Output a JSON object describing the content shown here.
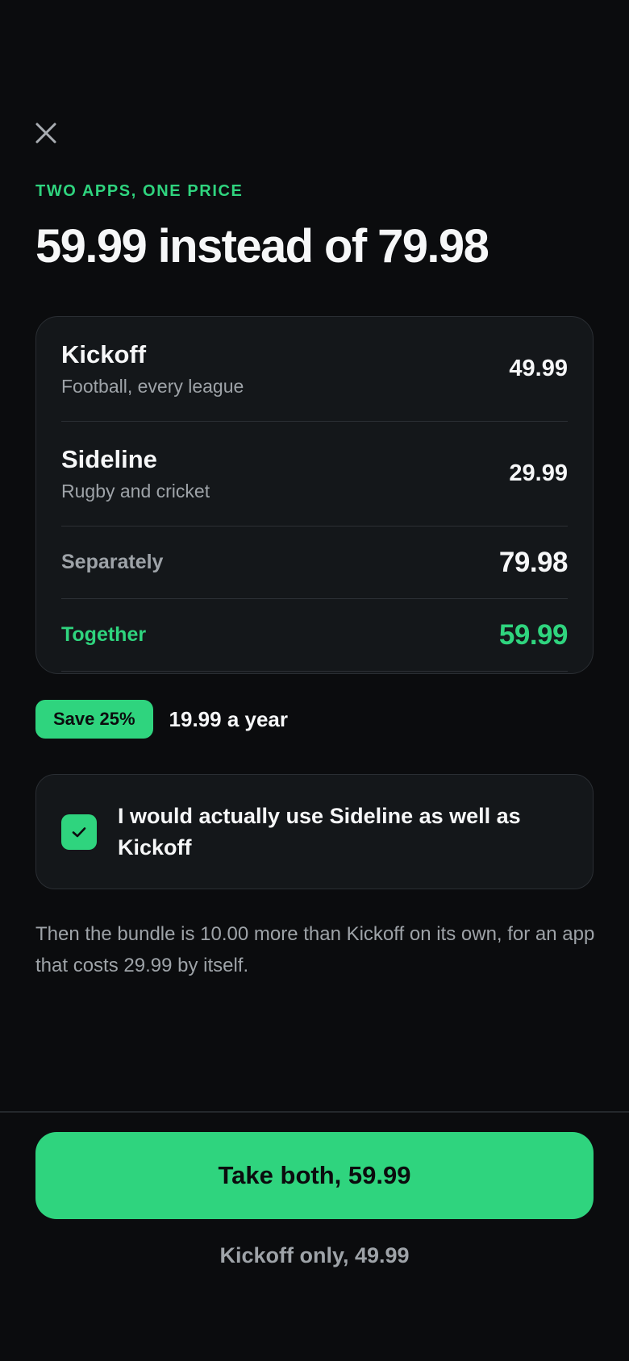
{
  "header": {
    "close_icon": "close-icon",
    "eyebrow": "TWO APPS, ONE PRICE",
    "headline": "59.99 instead of 79.98"
  },
  "comparison": {
    "apps": [
      {
        "name": "Kickoff",
        "description": "Football, every league",
        "price": "49.99"
      },
      {
        "name": "Sideline",
        "description": "Rugby and cricket",
        "price": "29.99"
      }
    ],
    "separately_label": "Separately",
    "separately_value": "79.98",
    "together_label": "Together",
    "together_value": "59.99"
  },
  "savings": {
    "badge": "Save 25%",
    "text": "19.99 a year"
  },
  "confirm": {
    "checked": true,
    "check_icon": "checkmark-icon",
    "text": "I would actually use Sideline as well as Kickoff"
  },
  "explanation": "Then the bundle is 10.00 more than Kickoff on its own, for an app that costs 29.99 by itself.",
  "actions": {
    "primary_label": "Take both, 59.99",
    "secondary_label": "Kickoff only, 49.99"
  },
  "colors": {
    "background": "#0b0c0e",
    "card": "#14171a",
    "accent": "#2fd47e",
    "muted_text": "#9ea3a8",
    "primary_text": "#f6f7f8"
  }
}
